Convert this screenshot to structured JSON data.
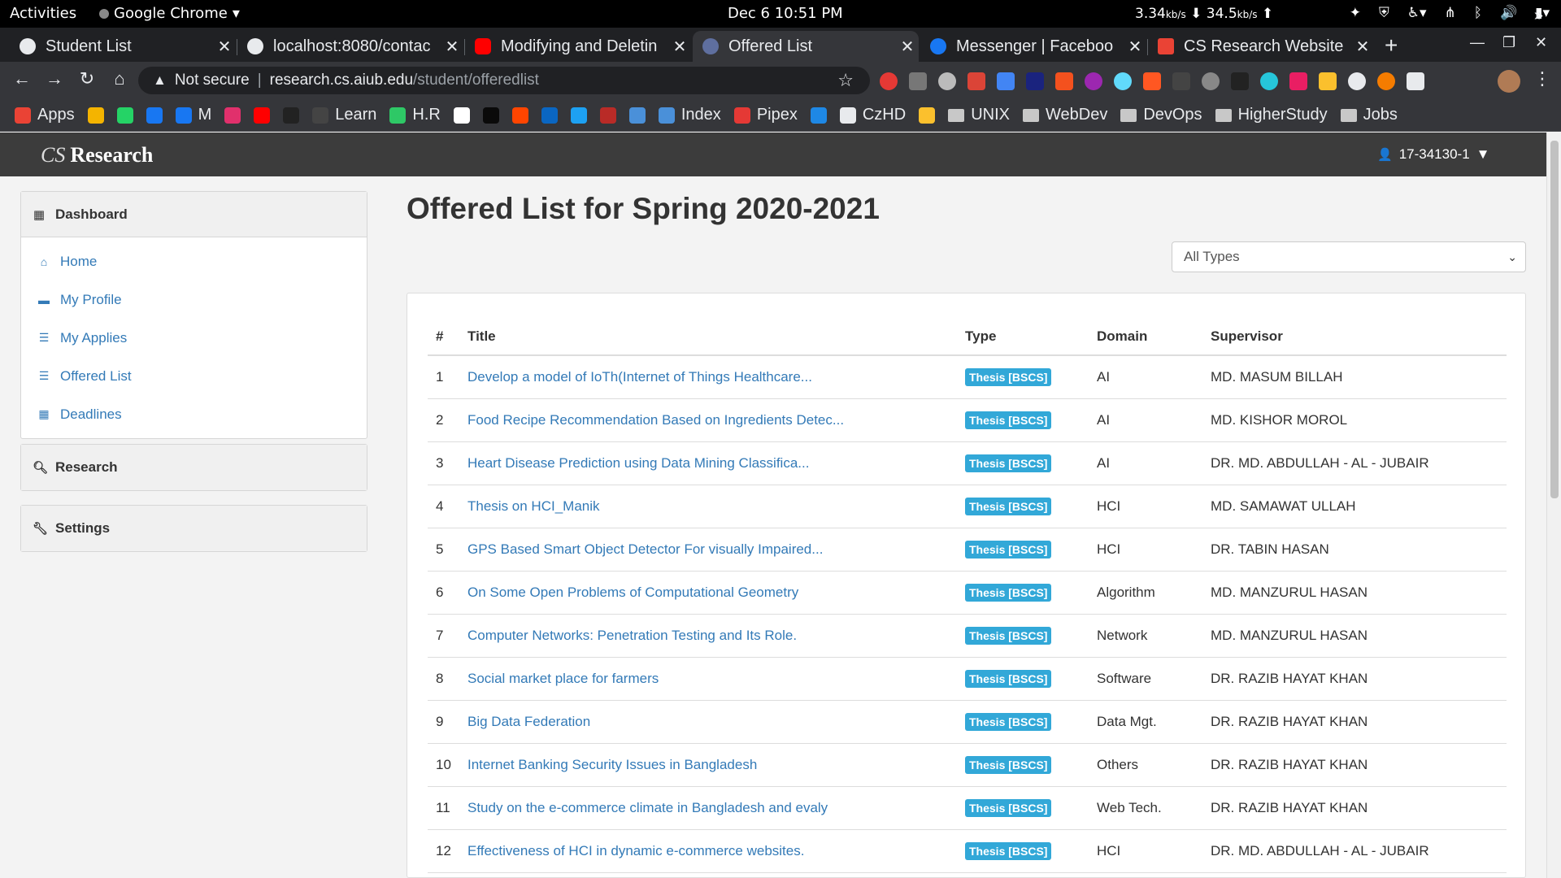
{
  "os_bar": {
    "activities": "Activities",
    "app_name": "Google Chrome",
    "clock": "Dec 6  10:51 PM",
    "net_down": "3.34",
    "net_down_unit": "kb/s",
    "net_up": "34.5",
    "net_up_unit": "kb/s"
  },
  "tabs": [
    {
      "title": "Student List",
      "favicon_color": "#e8eaed"
    },
    {
      "title": "localhost:8080/contac",
      "favicon_color": "#e8eaed"
    },
    {
      "title": "Modifying and Deletin",
      "favicon_color": "#ff0000"
    },
    {
      "title": "Offered List",
      "favicon_color": "#5f6f9f"
    },
    {
      "title": "Messenger | Faceboo",
      "favicon_color": "#1877f2"
    },
    {
      "title": "CS Research Website",
      "favicon_color": "#ea4335"
    }
  ],
  "address": {
    "security": "Not secure",
    "host": "research.cs.aiub.edu",
    "path": "/student/offeredlist"
  },
  "bookmarks": [
    {
      "label": "Apps",
      "color": "#ea4335"
    },
    {
      "label": "",
      "color": "#f4b400"
    },
    {
      "label": "",
      "color": "#25d366"
    },
    {
      "label": "",
      "color": "#1877f2"
    },
    {
      "label": "M",
      "color": "#1877f2"
    },
    {
      "label": "",
      "color": "#e1306c"
    },
    {
      "label": "",
      "color": "#ff0000"
    },
    {
      "label": "",
      "color": "#222222"
    },
    {
      "label": "Learn",
      "color": "#444444"
    },
    {
      "label": "H.R",
      "color": "#2ec866"
    },
    {
      "label": "",
      "color": "#ffffff"
    },
    {
      "label": "",
      "color": "#0a0a0a"
    },
    {
      "label": "",
      "color": "#ff4500"
    },
    {
      "label": "",
      "color": "#0a66c2"
    },
    {
      "label": "",
      "color": "#1da1f2"
    },
    {
      "label": "",
      "color": "#b92b27"
    },
    {
      "label": "",
      "color": "#4a90d9"
    },
    {
      "label": "Index",
      "color": "#4a90d9"
    },
    {
      "label": "Pipex",
      "color": "#e53935"
    },
    {
      "label": "",
      "color": "#1e88e5"
    },
    {
      "label": "CzHD",
      "color": "#e8eaed"
    },
    {
      "label": "",
      "color": "#fbc02d"
    },
    {
      "label": "UNIX",
      "folder": true
    },
    {
      "label": "WebDev",
      "folder": true
    },
    {
      "label": "DevOps",
      "folder": true
    },
    {
      "label": "HigherStudy",
      "folder": true
    },
    {
      "label": "Jobs",
      "folder": true
    }
  ],
  "site": {
    "brand_cs": "CS",
    "brand_research": "Research",
    "user_id": "17-34130-1"
  },
  "sidebar": {
    "dashboard_label": "Dashboard",
    "items": [
      {
        "label": "Home",
        "icon": "home-icon",
        "glyph": "⌂"
      },
      {
        "label": "My Profile",
        "icon": "briefcase-icon",
        "glyph": "▬"
      },
      {
        "label": "My Applies",
        "icon": "list-icon",
        "glyph": "☰"
      },
      {
        "label": "Offered List",
        "icon": "list-icon",
        "glyph": "☰"
      },
      {
        "label": "Deadlines",
        "icon": "calendar-icon",
        "glyph": "▦"
      }
    ],
    "research_label": "Research",
    "settings_label": "Settings"
  },
  "main": {
    "title": "Offered List for Spring 2020-2021",
    "filter_value": "All Types",
    "columns": [
      "#",
      "Title",
      "Type",
      "Domain",
      "Supervisor"
    ],
    "rows": [
      {
        "num": "1",
        "title": "Develop a model of IoTh(Internet of Things Healthcare...",
        "type": "Thesis [BSCS]",
        "domain": "AI",
        "supervisor": "MD. MASUM BILLAH"
      },
      {
        "num": "2",
        "title": "Food Recipe Recommendation Based on Ingredients Detec...",
        "type": "Thesis [BSCS]",
        "domain": "AI",
        "supervisor": "MD. KISHOR MOROL"
      },
      {
        "num": "3",
        "title": "Heart Disease Prediction using Data Mining Classifica...",
        "type": "Thesis [BSCS]",
        "domain": "AI",
        "supervisor": "DR. MD. ABDULLAH - AL - JUBAIR"
      },
      {
        "num": "4",
        "title": "Thesis on HCI_Manik",
        "type": "Thesis [BSCS]",
        "domain": "HCI",
        "supervisor": "MD. SAMAWAT ULLAH"
      },
      {
        "num": "5",
        "title": "GPS Based Smart Object Detector For visually Impaired...",
        "type": "Thesis [BSCS]",
        "domain": "HCI",
        "supervisor": "DR. TABIN HASAN"
      },
      {
        "num": "6",
        "title": "On Some Open Problems of Computational Geometry",
        "type": "Thesis [BSCS]",
        "domain": "Algorithm",
        "supervisor": "MD. MANZURUL HASAN"
      },
      {
        "num": "7",
        "title": "Computer Networks: Penetration Testing and Its Role.",
        "type": "Thesis [BSCS]",
        "domain": "Network",
        "supervisor": "MD. MANZURUL HASAN"
      },
      {
        "num": "8",
        "title": "Social market place for farmers",
        "type": "Thesis [BSCS]",
        "domain": "Software",
        "supervisor": "DR. RAZIB HAYAT KHAN"
      },
      {
        "num": "9",
        "title": "Big Data Federation",
        "type": "Thesis [BSCS]",
        "domain": "Data Mgt.",
        "supervisor": "DR. RAZIB HAYAT KHAN"
      },
      {
        "num": "10",
        "title": "Internet Banking Security Issues in Bangladesh",
        "type": "Thesis [BSCS]",
        "domain": "Others",
        "supervisor": "DR. RAZIB HAYAT KHAN"
      },
      {
        "num": "11",
        "title": "Study on the e-commerce climate in Bangladesh and evaly",
        "type": "Thesis [BSCS]",
        "domain": "Web Tech.",
        "supervisor": "DR. RAZIB HAYAT KHAN"
      },
      {
        "num": "12",
        "title": "Effectiveness of HCI in dynamic e-commerce websites.",
        "type": "Thesis [BSCS]",
        "domain": "HCI",
        "supervisor": "DR. MD. ABDULLAH - AL - JUBAIR"
      }
    ]
  },
  "colors": {
    "link": "#337ab7",
    "badge": "#32a8d8",
    "site_nav": "#3c3c3c",
    "chrome_dark": "#202124",
    "chrome_toolbar": "#35363a"
  }
}
